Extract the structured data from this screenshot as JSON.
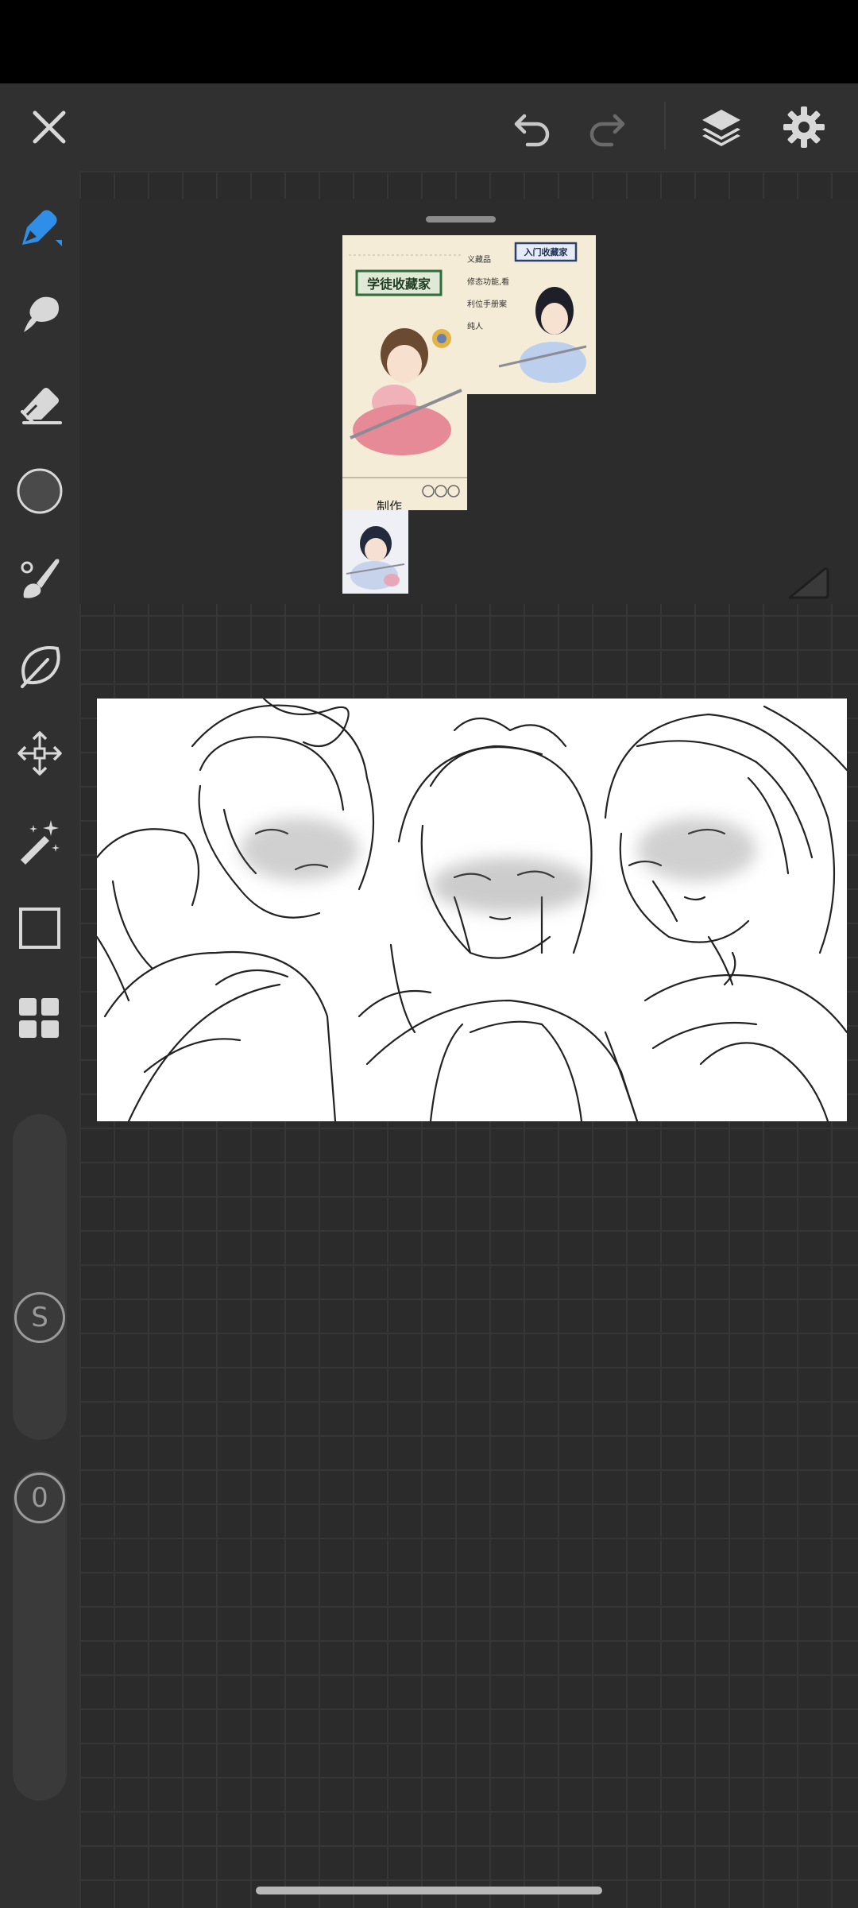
{
  "app": {
    "name": "drawing-canvas"
  },
  "toolbar": {
    "close_icon": "close-icon",
    "undo_icon": "undo-icon",
    "redo_icon": "redo-icon",
    "layers_icon": "layers-icon",
    "settings_icon": "gear-icon"
  },
  "tools": [
    {
      "name": "pen",
      "icon": "pen-icon",
      "active": true
    },
    {
      "name": "smudge",
      "icon": "smudge-icon"
    },
    {
      "name": "eraser",
      "icon": "eraser-icon"
    },
    {
      "name": "color",
      "icon": "color-swatch",
      "color": "#4a4a4a"
    },
    {
      "name": "brush",
      "icon": "brush-icon"
    },
    {
      "name": "lasso",
      "icon": "lasso-icon"
    },
    {
      "name": "transform",
      "icon": "move-icon"
    },
    {
      "name": "magic-wand",
      "icon": "magic-wand-icon"
    },
    {
      "name": "shape",
      "icon": "rectangle-icon"
    },
    {
      "name": "gallery",
      "icon": "grid-icon"
    }
  ],
  "sliders": {
    "size_label": "S",
    "opacity_value": "0"
  },
  "reference": {
    "caption": "制作",
    "banner_main": "学徒收藏家",
    "banner_right": "入门收藏家",
    "lines": [
      "义藏品",
      "修态功能,看",
      "利位手册案",
      "纯人"
    ]
  },
  "colors": {
    "accent": "#2f8fe8",
    "background": "#2b2b2b",
    "panel": "#303030"
  }
}
